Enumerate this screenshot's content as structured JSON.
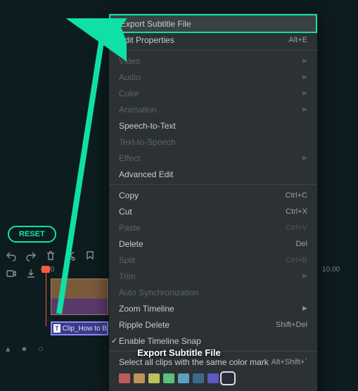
{
  "reset_label": "RESET",
  "menu": {
    "export_subtitle": "Export Subtitle File",
    "edit_properties": "Edit Properties",
    "edit_properties_sc": "Alt+E",
    "video": "Video",
    "audio": "Audio",
    "color": "Color",
    "animation": "Animation",
    "speech_to_text": "Speech-to-Text",
    "text_to_speech": "Text-to-Speech",
    "effect": "Effect",
    "advanced_edit": "Advanced Edit",
    "copy": "Copy",
    "copy_sc": "Ctrl+C",
    "cut": "Cut",
    "cut_sc": "Ctrl+X",
    "paste": "Paste",
    "paste_sc": "Ctrl+V",
    "delete": "Delete",
    "delete_sc": "Del",
    "split": "Split",
    "split_sc": "Ctrl+B",
    "trim": "Trim",
    "auto_sync": "Auto Synchronization",
    "zoom_timeline": "Zoom Timeline",
    "ripple_delete": "Ripple Delete",
    "ripple_delete_sc": "Shift+Del",
    "enable_snap": "Enable Timeline Snap",
    "select_color": "Select all clips with the same color mark",
    "select_color_sc": "Alt+Shift+`"
  },
  "colors": [
    "#c05a5a",
    "#c0925a",
    "#c0c05a",
    "#5ac07a",
    "#5aa0c0",
    "#3a6a8a",
    "#5a5ac0",
    "#2a2a3a"
  ],
  "selected_color_index": 7,
  "timeline": {
    "tick0": "0.00",
    "tick_far": "10.00"
  },
  "clip": {
    "subtitle_label": "Clip_How to B"
  },
  "caption": "Export Subtitle File"
}
